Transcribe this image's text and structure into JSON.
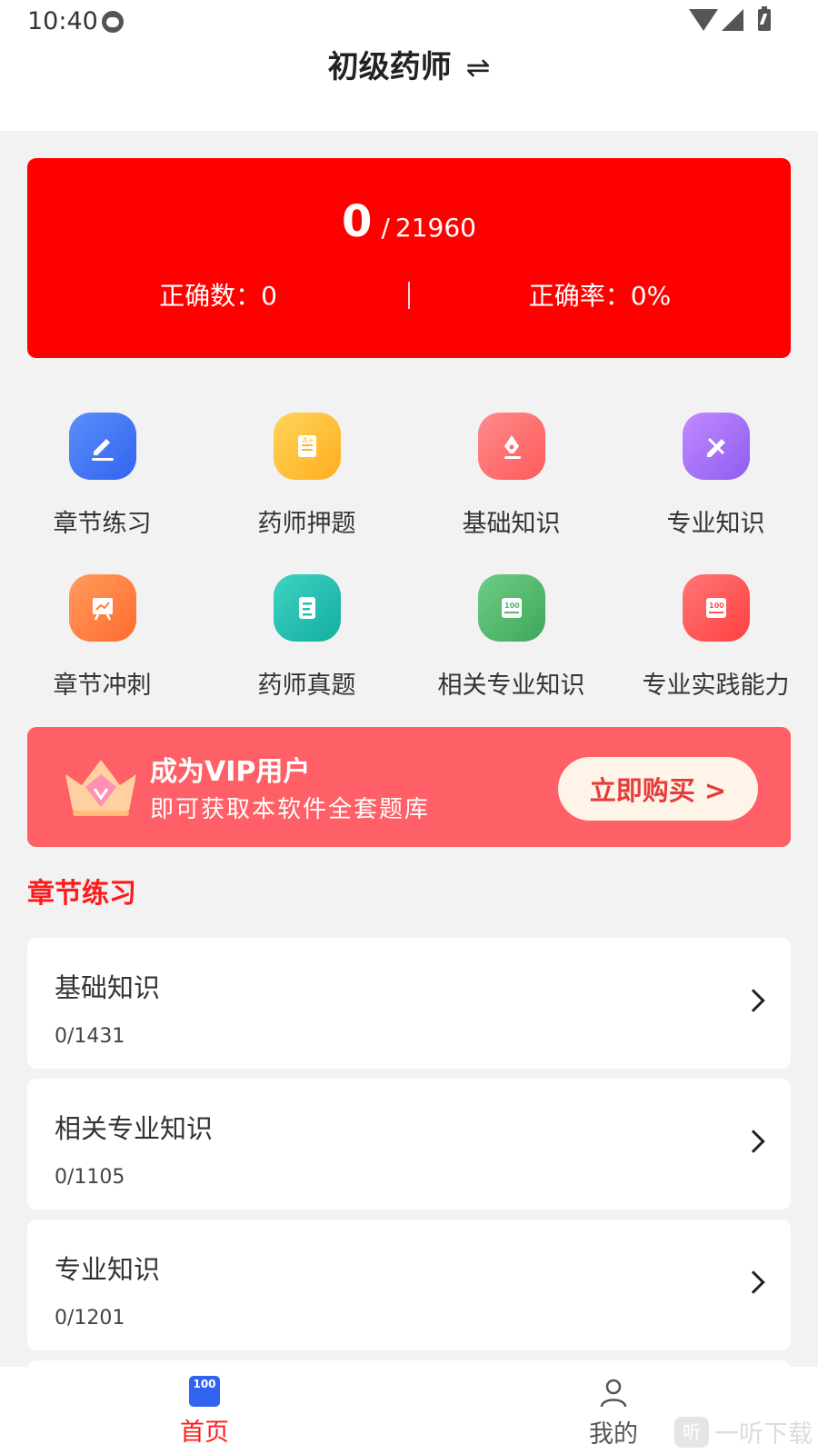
{
  "status": {
    "time": "10:40"
  },
  "header": {
    "title": "初级药师",
    "swap_icon": "⇌"
  },
  "stats": {
    "done": "0",
    "separator": "/",
    "total": "21960",
    "correct_count": "正确数：0",
    "correct_rate": "正确率：0%"
  },
  "features": [
    {
      "label": "章节练习",
      "icon": "edit-icon",
      "color": "#3b7cf6"
    },
    {
      "label": "药师押题",
      "icon": "scroll-icon",
      "color": "#ffbe2e"
    },
    {
      "label": "基础知识",
      "icon": "pen-nib-icon",
      "color": "#ff6b6b"
    },
    {
      "label": "专业知识",
      "icon": "pencil-icon",
      "color": "#a46af2"
    },
    {
      "label": "章节冲刺",
      "icon": "chart-board-icon",
      "color": "#ff7b3a"
    },
    {
      "label": "药师真题",
      "icon": "document-icon",
      "color": "#23bfb0"
    },
    {
      "label": "相关专业知识",
      "icon": "score-100-icon",
      "color": "#4fb86a"
    },
    {
      "label": "专业实践能力",
      "icon": "score-100-icon",
      "color": "#ff5454"
    }
  ],
  "vip": {
    "title": "成为VIP用户",
    "subtitle": "即可获取本软件全套题库",
    "button": "立即购买 >"
  },
  "section": {
    "title": "章节练习"
  },
  "chapters": [
    {
      "name": "基础知识",
      "progress": "0/1431"
    },
    {
      "name": "相关专业知识",
      "progress": "0/1105"
    },
    {
      "name": "专业知识",
      "progress": "0/1201"
    }
  ],
  "tabbar": {
    "home_icon_text": "100",
    "home": "首页",
    "mine": "我的"
  },
  "watermark": {
    "logo": "听",
    "text": "一听下载"
  },
  "colors": {
    "accent": "#ff0000",
    "vip_bg": "#ff5f66",
    "tab_active": "#ff1a1a"
  }
}
